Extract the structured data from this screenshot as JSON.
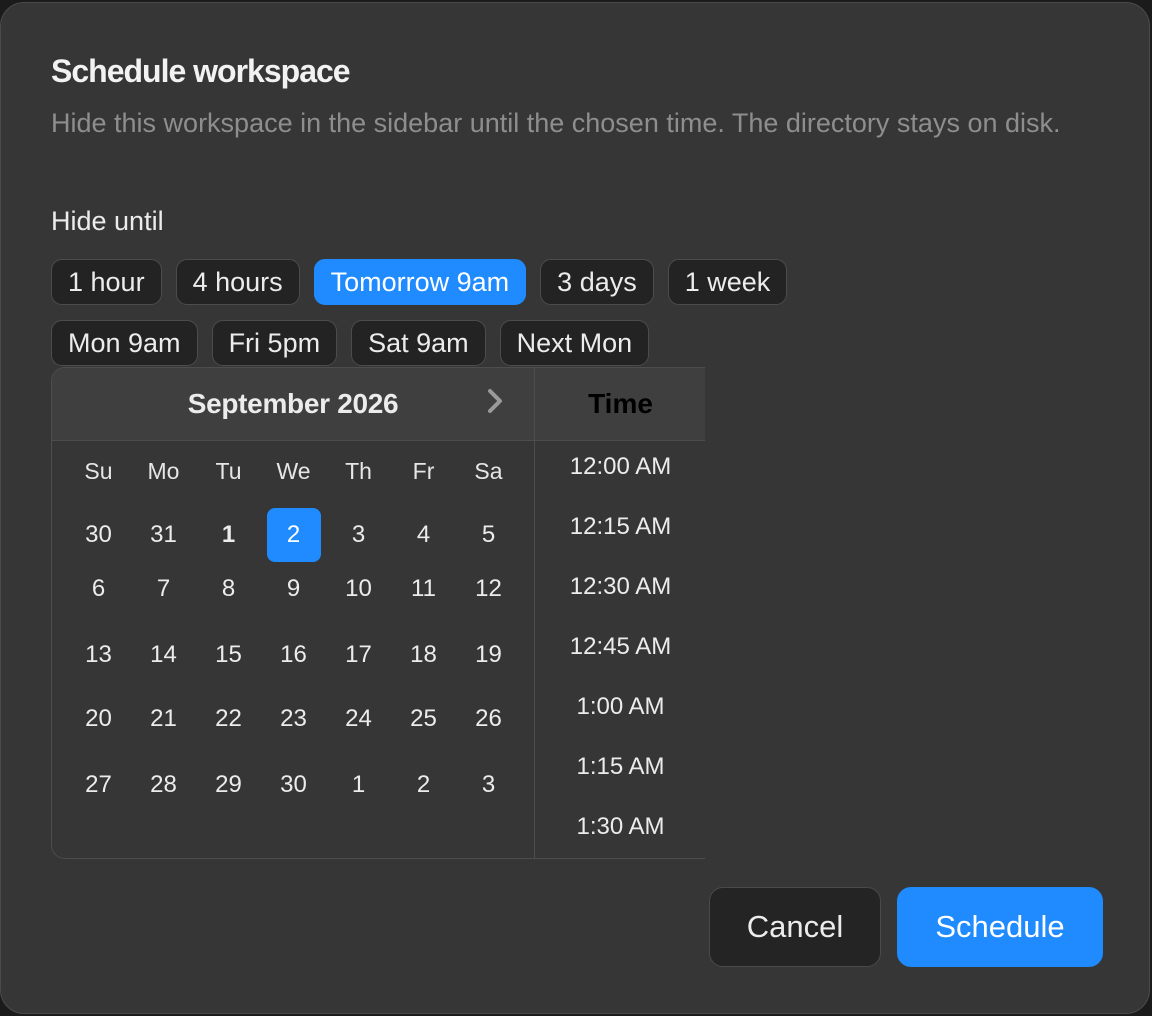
{
  "dialog": {
    "title": "Schedule workspace",
    "description": "Hide this workspace in the sidebar until the chosen time. The directory stays on disk.",
    "hide_until_label": "Hide until"
  },
  "presets": {
    "row1": [
      "1 hour",
      "4 hours",
      "Tomorrow 9am",
      "3 days",
      "1 week"
    ],
    "row2": [
      "Mon 9am",
      "Fri 5pm",
      "Sat 9am",
      "Next Mon"
    ],
    "selected": "Tomorrow 9am"
  },
  "calendar": {
    "month_label": "September 2026",
    "weekdays": [
      "Su",
      "Mo",
      "Tu",
      "We",
      "Th",
      "Fr",
      "Sa"
    ],
    "days": [
      "30",
      "31",
      "1",
      "2",
      "3",
      "4",
      "5",
      "6",
      "7",
      "8",
      "9",
      "10",
      "11",
      "12",
      "13",
      "14",
      "15",
      "16",
      "17",
      "18",
      "19",
      "20",
      "21",
      "22",
      "23",
      "24",
      "25",
      "26",
      "27",
      "28",
      "29",
      "30",
      "1",
      "2",
      "3"
    ],
    "today_index": 2,
    "selected_index": 3
  },
  "time": {
    "header": "Time",
    "options": [
      "12:00 AM",
      "12:15 AM",
      "12:30 AM",
      "12:45 AM",
      "1:00 AM",
      "1:15 AM",
      "1:30 AM"
    ]
  },
  "actions": {
    "cancel_label": "Cancel",
    "primary_label": "Schedule"
  },
  "colors": {
    "accent": "#1f8bff",
    "dialog_bg": "#363636",
    "chip_bg": "#232323"
  },
  "icons": {
    "next_month": "chevron-right-icon"
  }
}
